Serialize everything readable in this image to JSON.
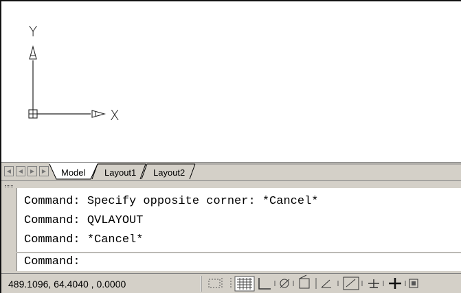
{
  "ucs": {
    "y_label": "Y",
    "x_label": "X"
  },
  "tabs": {
    "nav": [
      "first-tab",
      "previous-tab",
      "next-tab",
      "last-tab"
    ],
    "items": [
      {
        "label": "Model",
        "active": true
      },
      {
        "label": "Layout1",
        "active": false
      },
      {
        "label": "Layout2",
        "active": false
      }
    ]
  },
  "command_window": {
    "history": [
      "Command: Specify opposite corner: *Cancel*",
      "Command: QVLAYOUT",
      "Command: *Cancel*"
    ],
    "prompt": "Command:",
    "input_value": ""
  },
  "status_bar": {
    "coordinates": "489.1096, 64.4040 , 0.0000",
    "toggles": [
      {
        "name": "infer-constraints-icon",
        "on": false
      },
      {
        "name": "snap-mode-icon",
        "on": false
      },
      {
        "name": "grid-display-icon",
        "on": true
      },
      {
        "name": "ortho-mode-icon",
        "on": false
      },
      {
        "name": "polar-tracking-icon",
        "on": false
      },
      {
        "name": "object-snap-icon",
        "on": false
      },
      {
        "name": "3d-object-snap-icon",
        "on": false
      },
      {
        "name": "object-snap-tracking-icon",
        "on": false
      },
      {
        "name": "dynamic-ucs-icon",
        "on": false
      },
      {
        "name": "dynamic-input-icon",
        "on": false
      },
      {
        "name": "lineweight-icon",
        "on": false
      },
      {
        "name": "transparency-icon",
        "on": false
      }
    ]
  }
}
